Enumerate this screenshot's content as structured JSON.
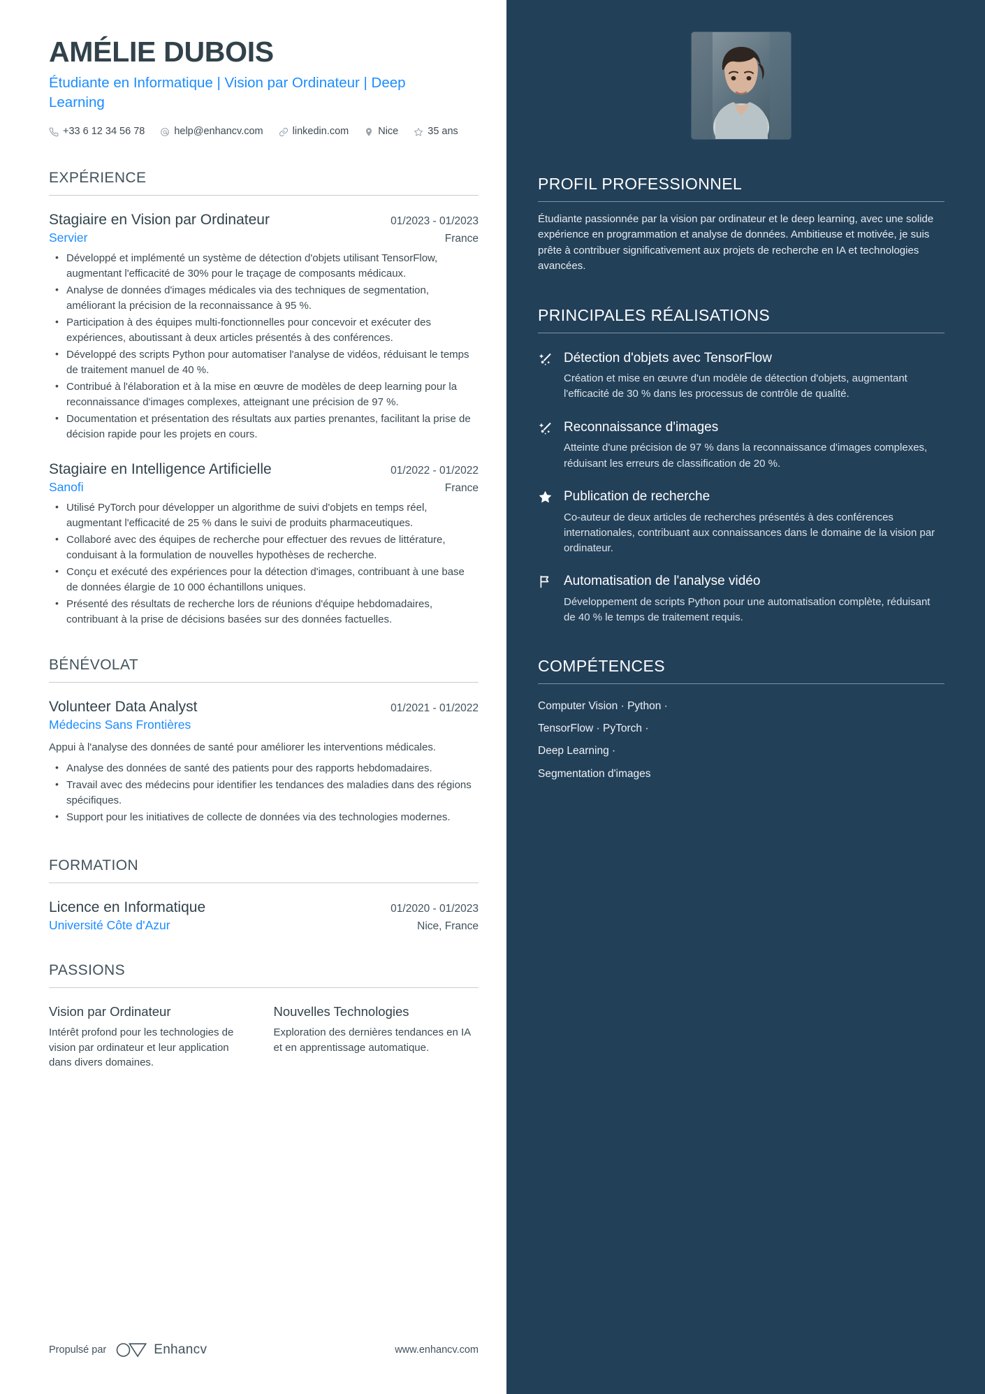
{
  "header": {
    "name": "AMÉLIE DUBOIS",
    "headline": "Étudiante en Informatique | Vision par Ordinateur | Deep Learning",
    "contacts": [
      {
        "icon": "phone-icon",
        "text": "+33 6 12 34 56 78"
      },
      {
        "icon": "email-icon",
        "text": "help@enhancv.com"
      },
      {
        "icon": "link-icon",
        "text": "linkedin.com"
      },
      {
        "icon": "location-pin-icon",
        "text": "Nice"
      },
      {
        "icon": "star-outline-icon",
        "text": "35 ans"
      }
    ]
  },
  "experience": {
    "title": "EXPÉRIENCE",
    "entries": [
      {
        "role": "Stagiaire en Vision par Ordinateur",
        "date": "01/2023 - 01/2023",
        "org": "Servier",
        "location": "France",
        "bullets": [
          "Développé et implémenté un système de détection d'objets utilisant TensorFlow, augmentant l'efficacité de 30% pour le traçage de composants médicaux.",
          "Analyse de données d'images médicales via des techniques de segmentation, améliorant la précision de la reconnaissance à 95 %.",
          "Participation à des équipes multi-fonctionnelles pour concevoir et exécuter des expériences, aboutissant à deux articles présentés à des conférences.",
          "Développé des scripts Python pour automatiser l'analyse de vidéos, réduisant le temps de traitement manuel de 40 %.",
          "Contribué à l'élaboration et à la mise en œuvre de modèles de deep learning pour la reconnaissance d'images complexes, atteignant une précision de 97 %.",
          "Documentation et présentation des résultats aux parties prenantes, facilitant la prise de décision rapide pour les projets en cours."
        ]
      },
      {
        "role": "Stagiaire en Intelligence Artificielle",
        "date": "01/2022 - 01/2022",
        "org": "Sanofi",
        "location": "France",
        "bullets": [
          "Utilisé PyTorch pour développer un algorithme de suivi d'objets en temps réel, augmentant l'efficacité de 25 % dans le suivi de produits pharmaceutiques.",
          "Collaboré avec des équipes de recherche pour effectuer des revues de littérature, conduisant à la formulation de nouvelles hypothèses de recherche.",
          "Conçu et exécuté des expériences pour la détection d'images, contribuant à une base de données élargie de 10 000 échantillons uniques.",
          "Présenté des résultats de recherche lors de réunions d'équipe hebdomadaires, contribuant à la prise de décisions basées sur des données factuelles."
        ]
      }
    ]
  },
  "volunteering": {
    "title": "BÉNÉVOLAT",
    "entries": [
      {
        "role": "Volunteer Data Analyst",
        "date": "01/2021 - 01/2022",
        "org": "Médecins Sans Frontières",
        "location": "",
        "description": "Appui à l'analyse des données de santé pour améliorer les interventions médicales.",
        "bullets": [
          "Analyse des données de santé des patients pour des rapports hebdomadaires.",
          "Travail avec des médecins pour identifier les tendances des maladies dans des régions spécifiques.",
          "Support pour les initiatives de collecte de données via des technologies modernes."
        ]
      }
    ]
  },
  "education": {
    "title": "FORMATION",
    "entries": [
      {
        "degree": "Licence en Informatique",
        "date": "01/2020 - 01/2023",
        "school": "Université Côte d'Azur",
        "location": "Nice, France"
      }
    ]
  },
  "passions": {
    "title": "PASSIONS",
    "items": [
      {
        "name": "Vision par Ordinateur",
        "description": "Intérêt profond pour les technologies de vision par ordinateur et leur application dans divers domaines."
      },
      {
        "name": "Nouvelles Technologies",
        "description": "Exploration des dernières tendances en IA et en apprentissage automatique."
      }
    ]
  },
  "footer": {
    "powered_by_label": "Propulsé par",
    "brand": "Enhancv",
    "url": "www.enhancv.com"
  },
  "sidebar": {
    "profile": {
      "title": "PROFIL PROFESSIONNEL",
      "text": "Étudiante passionnée par la vision par ordinateur et le deep learning, avec une solide expérience en programmation et analyse de données. Ambitieuse et motivée, je suis prête à contribuer significativement aux projets de recherche en IA et technologies avancées."
    },
    "achievements": {
      "title": "PRINCIPALES RÉALISATIONS",
      "items": [
        {
          "icon": "sparkle-icon",
          "title": "Détection d'objets avec TensorFlow",
          "description": "Création et mise en œuvre d'un modèle de détection d'objets, augmentant l'efficacité de 30 % dans les processus de contrôle de qualité."
        },
        {
          "icon": "sparkle-icon",
          "title": "Reconnaissance d'images",
          "description": "Atteinte d'une précision de 97 % dans la reconnaissance d'images complexes, réduisant les erreurs de classification de 20 %."
        },
        {
          "icon": "star-filled-icon",
          "title": "Publication de recherche",
          "description": "Co-auteur de deux articles de recherches présentés à des conférences internationales, contribuant aux connaissances dans le domaine de la vision par ordinateur."
        },
        {
          "icon": "flag-icon",
          "title": "Automatisation de l'analyse vidéo",
          "description": "Développement de scripts Python pour une automatisation complète, réduisant de 40 % le temps de traitement requis."
        }
      ]
    },
    "skills": {
      "title": "COMPÉTENCES",
      "lines": [
        "Computer Vision · Python ·",
        "TensorFlow · PyTorch ·",
        "Deep Learning ·",
        "Segmentation d'images"
      ]
    }
  },
  "colors": {
    "sidebar_bg": "#234059",
    "accent_blue": "#1a8cff",
    "heading": "#41525c",
    "body": "#3c4a52"
  }
}
